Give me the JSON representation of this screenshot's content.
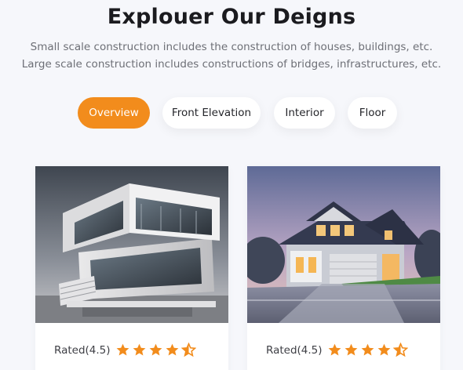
{
  "section": {
    "title": "Explouer Our Deigns",
    "subtitle_line1": "Small scale construction includes the construction of houses, buildings, etc.",
    "subtitle_line2": "Large scale construction includes constructions of bridges, infrastructures, etc."
  },
  "tabs": [
    {
      "label": "Overview",
      "active": true
    },
    {
      "label": "Front Elevation",
      "active": false
    },
    {
      "label": "Interior",
      "active": false
    },
    {
      "label": "Floor",
      "active": false
    }
  ],
  "cards": [
    {
      "rating_label": "Rated(4.5)",
      "rating": 4.5,
      "image_icon": "modern-house-image"
    },
    {
      "rating_label": "Rated(4.5)",
      "rating": 4.5,
      "image_icon": "suburban-house-image"
    }
  ],
  "colors": {
    "accent": "#f28c1c",
    "star": "#f28c1c",
    "background": "#f6f7fb",
    "title": "#1b1b1f"
  }
}
